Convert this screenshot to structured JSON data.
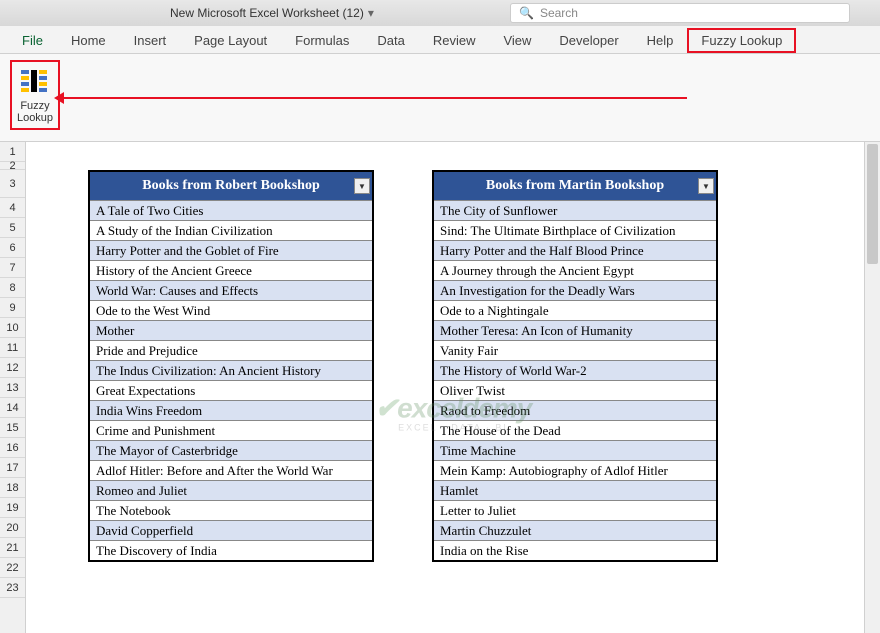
{
  "title": "New Microsoft Excel Worksheet (12)",
  "search": {
    "placeholder": "Search"
  },
  "tabs": {
    "file": "File",
    "home": "Home",
    "insert": "Insert",
    "pageLayout": "Page Layout",
    "formulas": "Formulas",
    "data": "Data",
    "review": "Review",
    "view": "View",
    "developer": "Developer",
    "help": "Help",
    "fuzzyLookup": "Fuzzy Lookup"
  },
  "ribbon": {
    "fuzzyLabel1": "Fuzzy",
    "fuzzyLabel2": "Lookup"
  },
  "rows": [
    "1",
    "2",
    "3",
    "4",
    "5",
    "6",
    "7",
    "8",
    "9",
    "10",
    "11",
    "12",
    "13",
    "14",
    "15",
    "16",
    "17",
    "18",
    "19",
    "20",
    "21",
    "22",
    "23"
  ],
  "table1": {
    "header": "Books from Robert Bookshop",
    "rows": [
      "A Tale of Two Cities",
      "A Study of the Indian Civilization",
      "Harry Potter and the Goblet of Fire",
      "History of the Ancient Greece",
      "World War: Causes and Effects",
      "Ode to the West Wind",
      "Mother",
      "Pride and Prejudice",
      "The Indus Civilization: An Ancient History",
      "Great Expectations",
      "India Wins Freedom",
      "Crime and Punishment",
      "The Mayor of Casterbridge",
      "Adlof Hitler: Before and After the World War",
      "Romeo and Juliet",
      "The Notebook",
      "David Copperfield",
      "The Discovery of India"
    ]
  },
  "table2": {
    "header": "Books from Martin Bookshop",
    "rows": [
      "The City of Sunflower",
      "Sind: The Ultimate Birthplace of Civilization",
      "Harry Potter and the Half Blood Prince",
      "A Journey through the Ancient Egypt",
      "An Investigation for the Deadly Wars",
      "Ode to a Nightingale",
      "Mother Teresa: An Icon of Humanity",
      "Vanity Fair",
      "The History of World War-2",
      "Oliver Twist",
      "Raod to Freedom",
      "The House of the Dead",
      "Time Machine",
      "Mein Kamp: Autobiography of Adlof Hitler",
      "Hamlet",
      "Letter to Juliet",
      "Martin Chuzzulet",
      "India on the Rise"
    ]
  },
  "watermark": {
    "brand": "exceldemy",
    "tagline": "EXCEL · DATA · BI"
  }
}
